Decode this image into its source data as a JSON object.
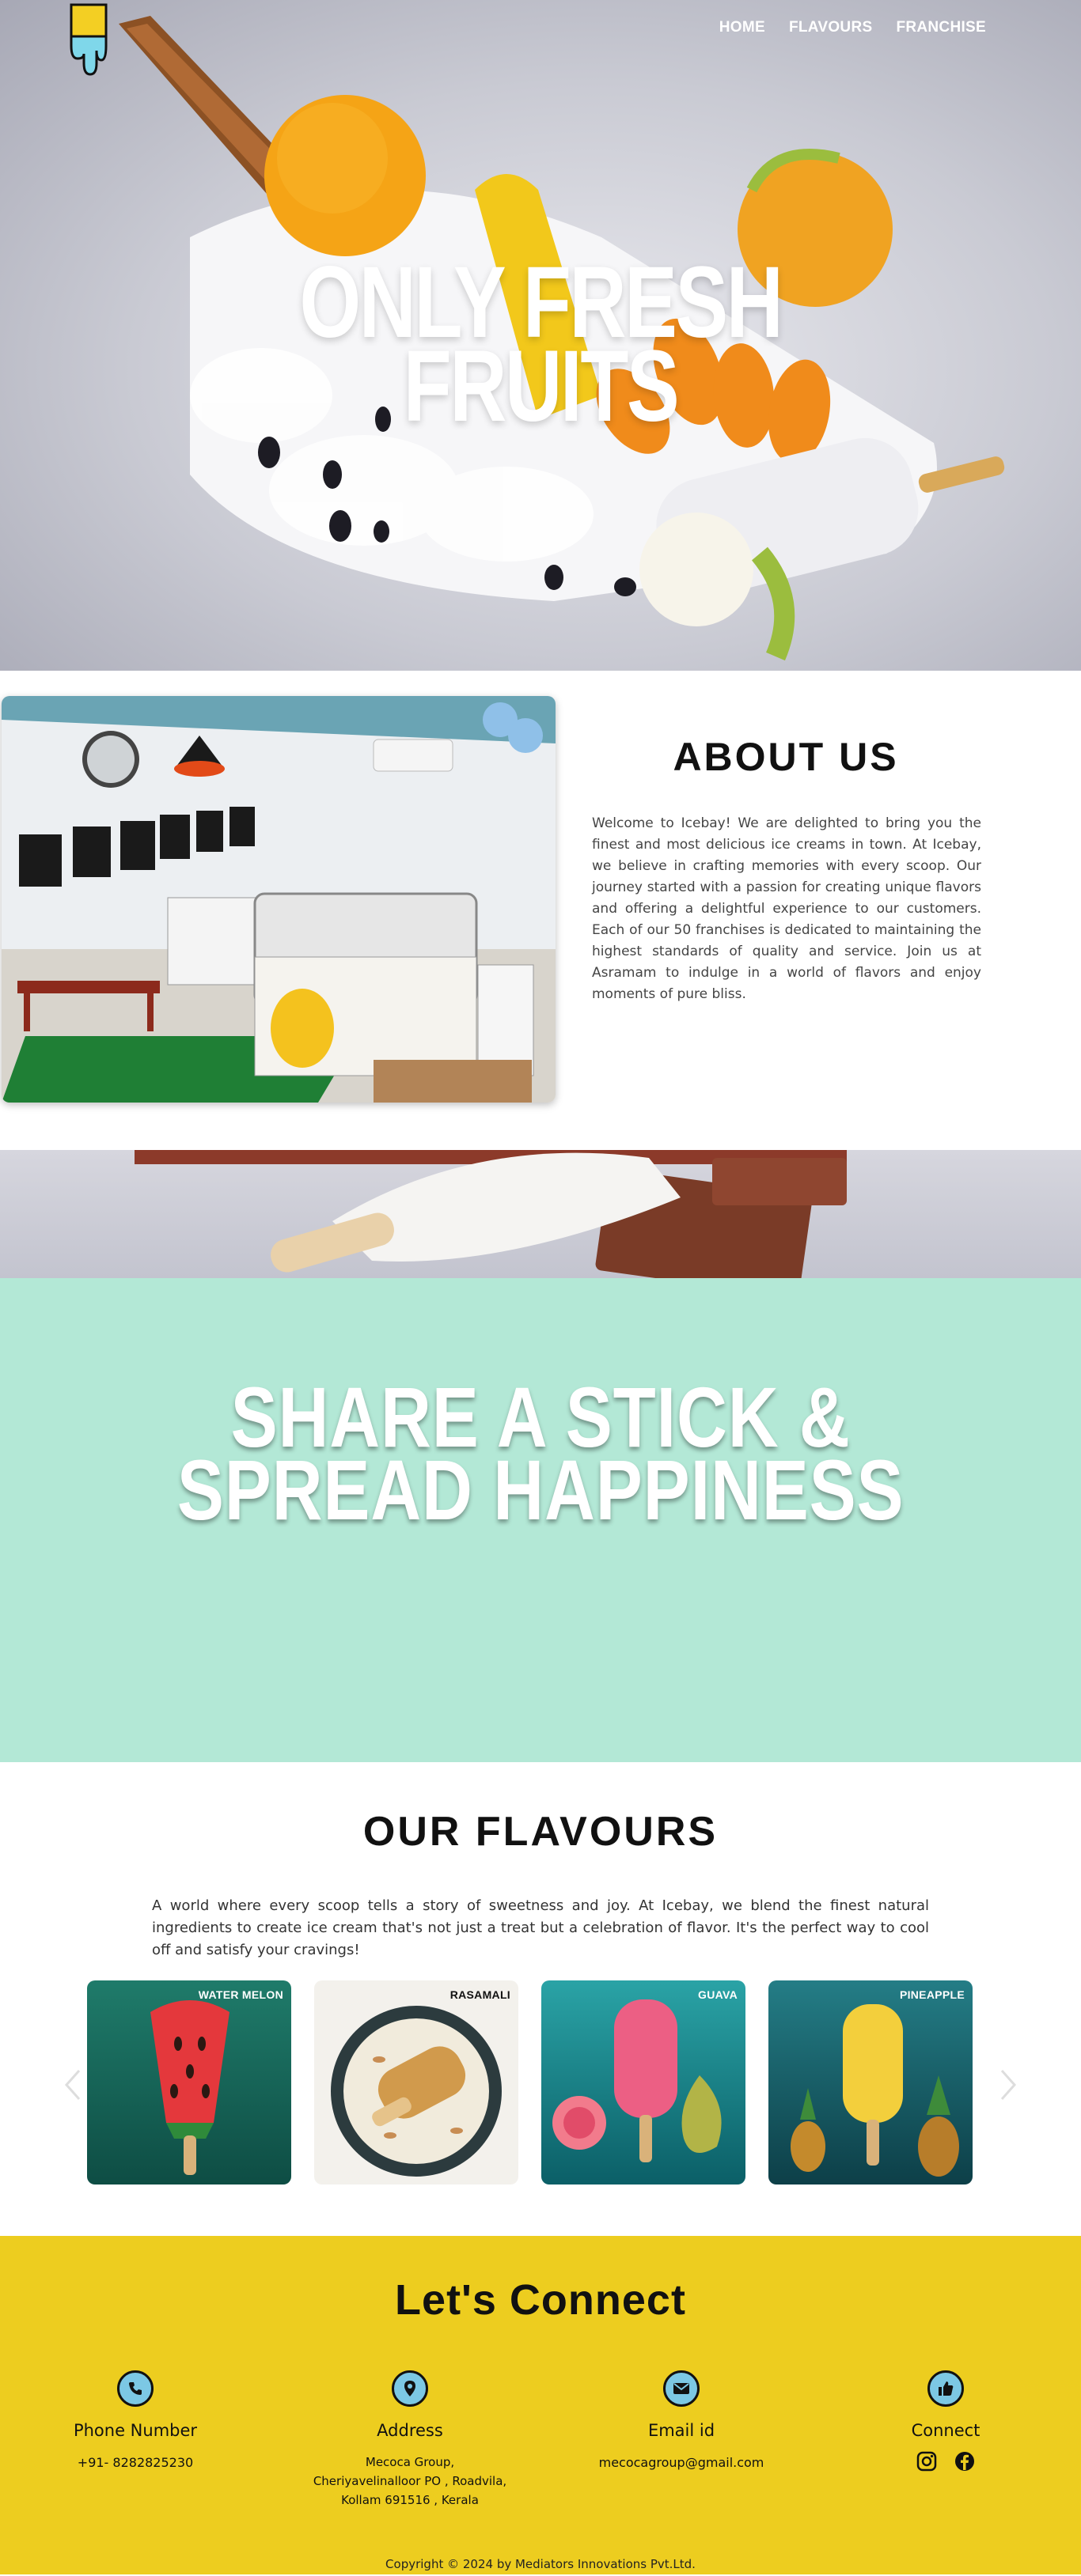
{
  "nav": {
    "items": [
      "HOME",
      "FLAVOURS",
      "FRANCHISE"
    ]
  },
  "hero": {
    "title_line1": "ONLY FRESH",
    "title_line2": "FRUITS"
  },
  "about": {
    "title": "ABOUT US",
    "text": "Welcome to Icebay! We are delighted to bring you the finest and most delicious ice creams in town. At Icebay, we believe in crafting memories with every scoop. Our journey started with a passion for creating unique flavors and offering a delightful experience to our customers. Each of our 50 franchises is dedicated to maintaining the highest standards of quality and service. Join us at Asramam to indulge in a world of flavors and enjoy moments of pure bliss."
  },
  "share": {
    "line1": "SHARE A STICK &",
    "line2": "SPREAD HAPPINESS"
  },
  "flavours": {
    "title": "OUR FLAVOURS",
    "text": "A world where every scoop tells a story of sweetness and joy. At Icebay, we blend the finest natural ingredients to create ice cream that's not just a treat but a celebration of flavor. It's the perfect way to cool off and satisfy your cravings!",
    "cards": [
      "WATER MELON",
      "RASAMALI",
      "GUAVA",
      "PINEAPPLE"
    ]
  },
  "connect": {
    "title": "Let's Connect",
    "phone": {
      "label": "Phone Number",
      "value": "+91- 8282825230"
    },
    "address": {
      "label": "Address",
      "line1": "Mecoca Group,",
      "line2": "Cheriyavelinalloor PO , Roadvila,",
      "line3": "Kollam 691516 , Kerala"
    },
    "email": {
      "label": "Email id",
      "value": "mecocagroup@gmail.com"
    },
    "social": {
      "label": "Connect"
    },
    "copyright": "Copyright © 2024 by Mediators Innovations Pvt.Ltd."
  },
  "colors": {
    "mint": "#b3e8d6",
    "yellow": "#edcd1f",
    "icon_blue": "#7cc8e4"
  }
}
